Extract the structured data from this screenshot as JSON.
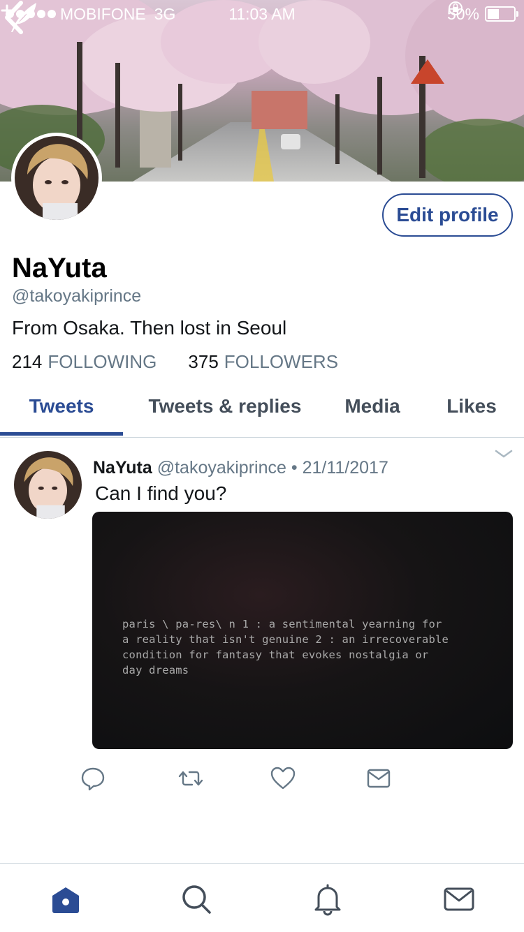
{
  "status_bar": {
    "carrier": "MOBIFONE",
    "network": "3G",
    "time": "11:03 AM",
    "battery": "50%"
  },
  "header": {
    "back_icon": "chevron-left-icon",
    "compose_icon": "feather-sparkle-icon"
  },
  "profile": {
    "edit_label": "Edit profile",
    "display_name": "NaYuta",
    "handle": "@takoyakiprince",
    "bio": "From Osaka. Then lost in Seoul",
    "following_count": "214",
    "following_label": "FOLLOWING",
    "followers_count": "375",
    "followers_label": "FOLLOWERS"
  },
  "tabs": [
    {
      "label": "Tweets",
      "active": true
    },
    {
      "label": "Tweets & replies",
      "active": false
    },
    {
      "label": "Media",
      "active": false
    },
    {
      "label": "Likes",
      "active": false
    }
  ],
  "tweet": {
    "name": "NaYuta",
    "handle": "@takoyakiprince",
    "separator": "•",
    "date": "21/11/2017",
    "text": "Can I find you?",
    "media_text": "paris \\ pa-res\\ n 1 : a sentimental yearning for\na reality that isn't genuine 2 : an irrecoverable\ncondition for fantasy that evokes nostalgia or\nday dreams"
  },
  "tweet_actions": [
    "reply-icon",
    "retweet-icon",
    "like-icon",
    "direct-message-icon"
  ],
  "bottom_nav": [
    "home-icon",
    "search-icon",
    "notifications-icon",
    "messages-icon"
  ],
  "colors": {
    "accent": "#2b4c94",
    "secondary_text": "#657786",
    "divider": "#ccd6dd"
  }
}
